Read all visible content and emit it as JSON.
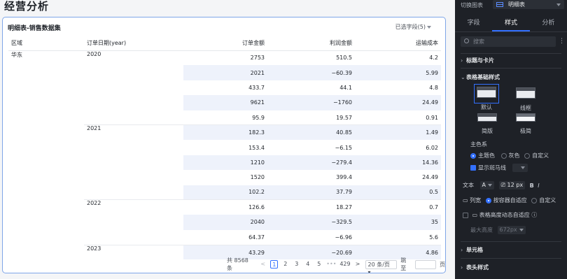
{
  "page": {
    "title": "经营分析"
  },
  "card": {
    "title": "明细表-销售数据集",
    "field_selector": "已选字段(5)"
  },
  "table": {
    "headers": [
      "区域",
      "订单日期(year)",
      "订单金额",
      "利润金额",
      "运输成本"
    ],
    "rows": [
      {
        "region": "华东",
        "date": "2020",
        "amount": "2753",
        "profit": "510.5",
        "ship": "4.2",
        "zebra": false,
        "start": false
      },
      {
        "region": "",
        "date": "",
        "amount": "2021",
        "profit": "−60.39",
        "ship": "5.99",
        "zebra": true,
        "start": false
      },
      {
        "region": "",
        "date": "",
        "amount": "433.7",
        "profit": "44.1",
        "ship": "4.8",
        "zebra": false,
        "start": false
      },
      {
        "region": "",
        "date": "",
        "amount": "9621",
        "profit": "−1760",
        "ship": "24.49",
        "zebra": true,
        "start": false
      },
      {
        "region": "",
        "date": "",
        "amount": "95.9",
        "profit": "19.57",
        "ship": "0.91",
        "zebra": false,
        "start": false
      },
      {
        "region": "",
        "date": "2021",
        "amount": "182.3",
        "profit": "40.85",
        "ship": "1.49",
        "zebra": true,
        "start": true
      },
      {
        "region": "",
        "date": "",
        "amount": "153.4",
        "profit": "−6.15",
        "ship": "6.02",
        "zebra": false,
        "start": false
      },
      {
        "region": "",
        "date": "",
        "amount": "1210",
        "profit": "−279.4",
        "ship": "14.36",
        "zebra": true,
        "start": false
      },
      {
        "region": "",
        "date": "",
        "amount": "1520",
        "profit": "399.4",
        "ship": "24.49",
        "zebra": false,
        "start": false
      },
      {
        "region": "",
        "date": "",
        "amount": "102.2",
        "profit": "37.79",
        "ship": "0.5",
        "zebra": true,
        "start": false
      },
      {
        "region": "",
        "date": "2022",
        "amount": "126.6",
        "profit": "18.27",
        "ship": "0.7",
        "zebra": false,
        "start": true
      },
      {
        "region": "",
        "date": "",
        "amount": "2040",
        "profit": "−329.5",
        "ship": "35",
        "zebra": true,
        "start": false
      },
      {
        "region": "",
        "date": "",
        "amount": "64.37",
        "profit": "−6.96",
        "ship": "5.6",
        "zebra": false,
        "start": false
      },
      {
        "region": "",
        "date": "2023",
        "amount": "43.29",
        "profit": "−20.69",
        "ship": "4.86",
        "zebra": true,
        "start": true
      }
    ]
  },
  "pager": {
    "total": "共 8568 条",
    "prev": "<",
    "pages": [
      "1",
      "2",
      "3",
      "4",
      "5"
    ],
    "ellipsis": "•••",
    "last": "429",
    "next": ">",
    "page_size": "20 条/页",
    "jump_label": "跳至",
    "page_unit": "页"
  },
  "panel": {
    "switch_label": "切换图表",
    "chart_type": "明细表",
    "tabs": [
      "字段",
      "样式",
      "分析"
    ],
    "active_tab": "样式",
    "search_placeholder": "搜索",
    "more": "⋮",
    "sections": {
      "title_card": "标题与卡片",
      "table_base": "表格基础样式",
      "cell": "单元格",
      "header_style": "表头样式"
    },
    "style_options": [
      "默认",
      "线框",
      "简版",
      "极简"
    ],
    "main_color_label": "主色系",
    "color_options": [
      "主题色",
      "灰色",
      "自定义"
    ],
    "zebra_label": "显示斑马线",
    "text_label": "文本",
    "font_sample": "A",
    "font_size": "12",
    "font_unit": "px",
    "bold": "B",
    "italic": "I",
    "column_width_label": "列宽",
    "width_options": [
      "按容器自适应",
      "自定义"
    ],
    "row_height_label": "表格高度动态自适应",
    "info": "ⓘ",
    "max_height_label": "最大高度",
    "max_height_value": "672px"
  }
}
